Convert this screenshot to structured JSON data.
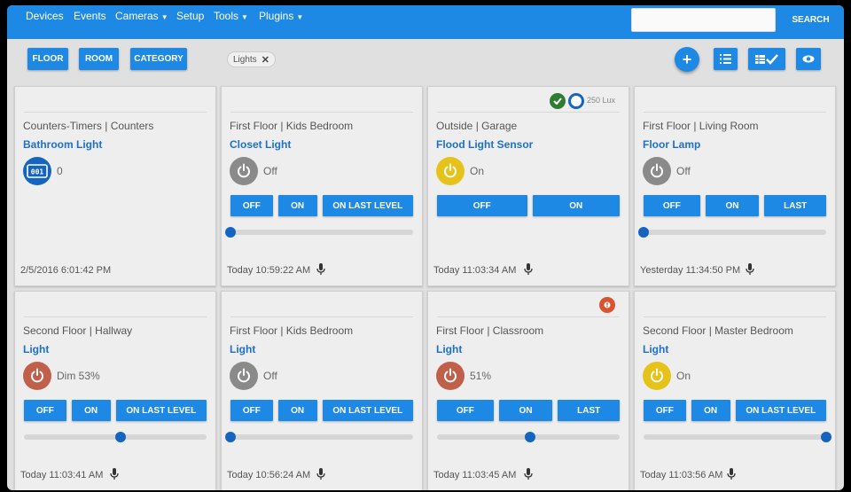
{
  "nav": {
    "items": [
      "Devices",
      "Events",
      "Cameras",
      "Setup",
      "Tools",
      "Plugins"
    ],
    "search_label": "SEARCH",
    "search_value": ""
  },
  "toolbar": {
    "floor": "FLOOR",
    "room": "ROOM",
    "category": "CATEGORY",
    "filter_chip": "Lights",
    "add_icon": "plus-icon",
    "list_icon": "list-icon",
    "grid_check_icon": "grid-check-icon",
    "eye_icon": "eye-icon"
  },
  "colors": {
    "accent": "#1e88e5",
    "off_gray": "#8a8a8a",
    "on_yellow": "#e6c31a",
    "dim_red": "#c0604a",
    "name_blue": "#1e70c8"
  },
  "cards": [
    {
      "location": "Counters-Timers | Counters",
      "name": "Bathroom Light",
      "state": "0",
      "icon": "counter-icon",
      "timestamp": "2/5/2016 6:01:42 PM",
      "buttons": []
    },
    {
      "location": "First Floor | Kids Bedroom",
      "name": "Closet Light",
      "state": "Off",
      "icon": "power-icon",
      "timestamp": "Today 10:59:22 AM",
      "buttons": [
        "OFF",
        "ON",
        "ON LAST LEVEL"
      ],
      "level": 0
    },
    {
      "location": "Outside | Garage",
      "name": "Flood Light Sensor",
      "state": "On",
      "icon": "power-icon",
      "timestamp": "Today 11:03:34 AM",
      "buttons": [
        "OFF",
        "ON"
      ],
      "lux": "250 Lux"
    },
    {
      "location": "First Floor | Living Room",
      "name": "Floor Lamp",
      "state": "Off",
      "icon": "power-icon",
      "timestamp": "Yesterday 11:34:50 PM",
      "buttons": [
        "OFF",
        "ON",
        "LAST"
      ],
      "level": 0
    },
    {
      "location": "Second Floor | Hallway",
      "name": "Light",
      "state": "Dim 53%",
      "icon": "power-icon",
      "timestamp": "Today 11:03:41 AM",
      "buttons": [
        "OFF",
        "ON",
        "ON LAST LEVEL"
      ],
      "level": 0.53
    },
    {
      "location": "First Floor | Kids Bedroom",
      "name": "Light",
      "state": "Off",
      "icon": "power-icon",
      "timestamp": "Today 10:56:24 AM",
      "buttons": [
        "OFF",
        "ON",
        "ON LAST LEVEL"
      ],
      "level": 0
    },
    {
      "location": "First Floor | Classroom",
      "name": "Light",
      "state": "51%",
      "icon": "power-icon",
      "timestamp": "Today 11:03:45 AM",
      "buttons": [
        "OFF",
        "ON",
        "LAST"
      ],
      "level": 0.51
    },
    {
      "location": "Second Floor | Master Bedroom",
      "name": "Light",
      "state": "On",
      "icon": "power-icon",
      "timestamp": "Today 11:03:56 AM",
      "buttons": [
        "OFF",
        "ON",
        "ON LAST LEVEL"
      ],
      "level": 1
    }
  ]
}
